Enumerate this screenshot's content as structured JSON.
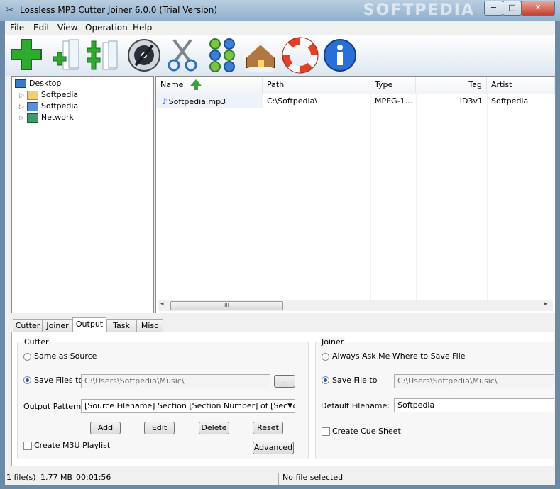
{
  "window": {
    "title": "Lossless MP3 Cutter Joiner 6.0.0 (Trial Version)",
    "watermark": "SOFTPEDIA",
    "minimize": "−",
    "maximize": "□",
    "close": "✕"
  },
  "menu": [
    "File",
    "Edit",
    "View",
    "Operation",
    "Help"
  ],
  "toolbar": {
    "icons": [
      "add-file-icon",
      "add-files-icon",
      "add-folder-icon",
      "cd-icon",
      "cut-icon",
      "join-icon",
      "home-icon",
      "help-icon",
      "about-icon"
    ]
  },
  "tree": {
    "items": [
      {
        "label": "Desktop",
        "icon": "desktop-icon"
      },
      {
        "label": "Softpedia",
        "icon": "folder-icon"
      },
      {
        "label": "Softpedia",
        "icon": "computer-icon"
      },
      {
        "label": "Network",
        "icon": "network-icon"
      }
    ]
  },
  "filelist": {
    "columns": [
      "Name",
      "Path",
      "Type",
      "Tag",
      "Artist"
    ],
    "rows": [
      {
        "name": "Softpedia.mp3",
        "path": "C:\\Softpedia\\",
        "type": "MPEG-1...",
        "tag": "ID3v1",
        "artist": "Softpedia"
      }
    ],
    "scroll_grip": "III"
  },
  "tabs": [
    "Cutter",
    "Joiner",
    "Output",
    "Task",
    "Misc"
  ],
  "active_tab": "Output",
  "cutter": {
    "group_label": "Cutter",
    "same_as_source": "Same as Source",
    "save_files_to": "Save Files to",
    "save_path": "C:\\Users\\Softpedia\\Music\\",
    "browse_label": "...",
    "output_pattern_label": "Output Pattern:",
    "output_pattern_value": "[Source Filename] Section [Section Number] of [Section Co",
    "add": "Add",
    "edit": "Edit",
    "delete": "Delete",
    "reset": "Reset",
    "create_m3u": "Create M3U Playlist",
    "advanced": "Advanced"
  },
  "joiner": {
    "group_label": "Joiner",
    "always_ask": "Always Ask Me Where to Save File",
    "save_file_to": "Save File to",
    "save_path": "C:\\Users\\Softpedia\\Music\\",
    "default_filename_label": "Default Filename:",
    "default_filename": "Softpedia",
    "create_cue": "Create Cue Sheet"
  },
  "status": {
    "files": "1 file(s)",
    "size": "1.77 MB",
    "duration": "00:01:56",
    "selection": "No file selected"
  },
  "colors": {
    "accent": "#1e5fb4",
    "green": "#2eaa2e",
    "titlebar": "#8fb0cc"
  }
}
